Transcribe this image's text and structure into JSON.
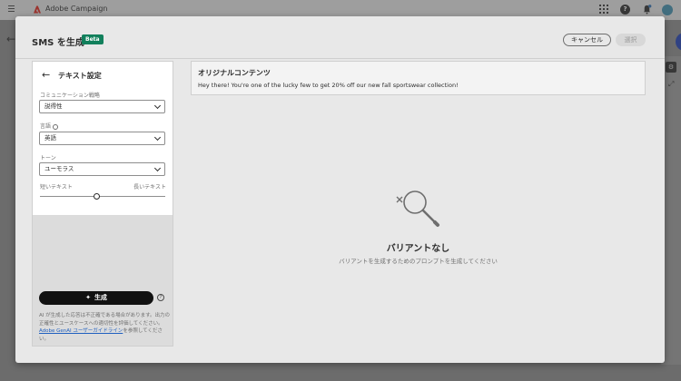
{
  "app": {
    "name": "Adobe Campaign",
    "back_glyph": "←"
  },
  "dialog": {
    "title": "SMS を生成",
    "badge": "Beta",
    "cancel_label": "キャンセル",
    "select_label": "選択"
  },
  "panel": {
    "title": "テキスト設定",
    "communication_label": "コミュニケーション戦略",
    "communication_value": "説得性",
    "language_label": "言語",
    "language_value": "英語",
    "tone_label": "トーン",
    "tone_value": "ユーモラス",
    "slider_min_label": "短いテキスト",
    "slider_max_label": "長いテキスト",
    "slider_level": 0.45,
    "generate_label": "生成",
    "disclaimer_text": "AI が生成した応答は不正確である場合があります。出力の正確性とユースケースへの適切性を評価してください。",
    "disclaimer_link": "Adobe GenAI ユーザーガイドライン",
    "disclaimer_suffix": "を参照してください。"
  },
  "original": {
    "title": "オリジナルコンテンツ",
    "text": "Hey there! You're one of the lucky few to get 20% off our new fall sportswear collection!"
  },
  "empty": {
    "title": "バリアントなし",
    "subtitle": "バリアントを生成するためのプロンプトを生成してください"
  },
  "colors": {
    "beta_badge": "#12805c",
    "generate_button": "#111111",
    "link": "#1f5fbf"
  },
  "icons": {
    "menu": "hamburger-icon",
    "back": "arrow-left-icon",
    "empty_state": "search-x-icon",
    "info": "info-icon",
    "help": "help-icon",
    "wand": "magic-wand-icon"
  }
}
